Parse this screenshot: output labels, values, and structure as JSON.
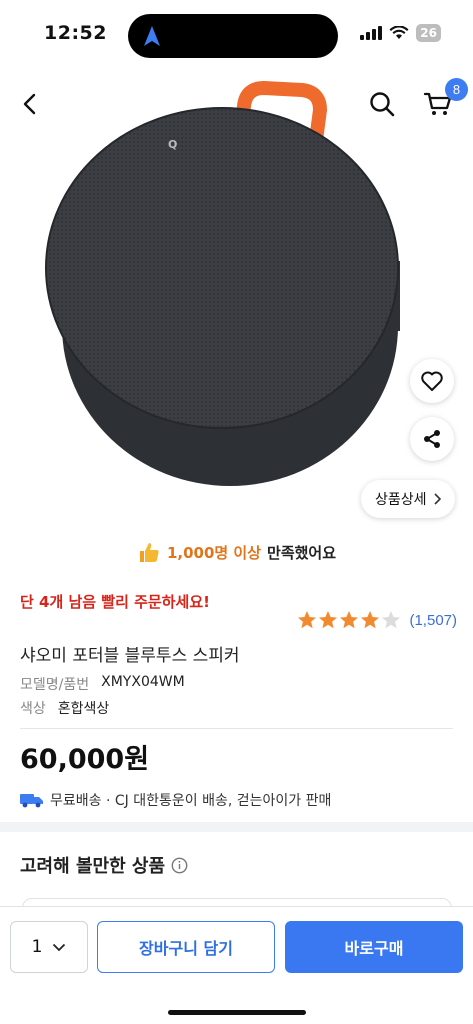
{
  "status_bar": {
    "time": "12:52",
    "battery": "26"
  },
  "header": {
    "cart_count": "8"
  },
  "image_actions": {
    "detail_label": "상품상세"
  },
  "satisfaction": {
    "highlight": "1,000명 이상",
    "rest": "만족했어요"
  },
  "urgency": "단 4개 남음 빨리 주문하세요!",
  "rating": {
    "stars": 4.5,
    "count": "(1,507)"
  },
  "product": {
    "name": "샤오미 포터블 블루투스 스피커",
    "specs": [
      {
        "key": "모델명/품번",
        "value": "XMYX04WM"
      },
      {
        "key": "색상",
        "value": "혼합색상"
      }
    ],
    "price": "60,000원",
    "delivery": "무료배송 · CJ 대한통운이 배송, 걷는아이가 판매"
  },
  "recommend": {
    "title": "고려해 볼만한 상품"
  },
  "bottom_bar": {
    "quantity": "1",
    "add_to_cart": "장바구니 담기",
    "buy_now": "바로구매"
  },
  "colors": {
    "accent": "#3a78f2",
    "urgent": "#d6261b",
    "star": "#f28b30"
  }
}
